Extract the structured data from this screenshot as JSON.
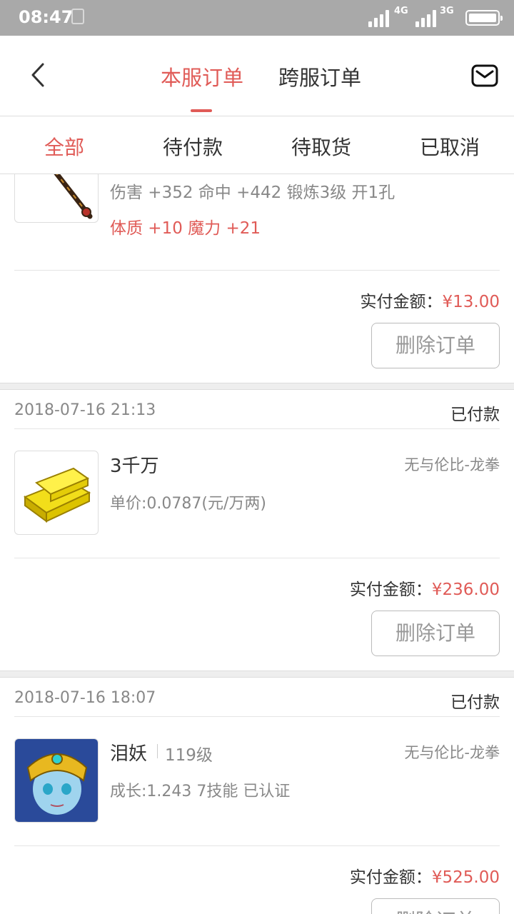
{
  "status_bar": {
    "time": "08:47",
    "net1": "4G",
    "net2": "3G"
  },
  "header": {
    "tabs": [
      {
        "label": "本服订单",
        "active": true
      },
      {
        "label": "跨服订单",
        "active": false
      }
    ]
  },
  "filters": [
    {
      "label": "全部",
      "active": true
    },
    {
      "label": "待付款",
      "active": false
    },
    {
      "label": "待取货",
      "active": false
    },
    {
      "label": "已取消",
      "active": false
    }
  ],
  "orders": [
    {
      "attr_line": "伤害 +352 命中 +442 锻炼3级 开1孔",
      "bonus_line": "体质 +10 魔力 +21",
      "paid_label": "实付金额：",
      "paid_amount": "¥13.00",
      "delete_label": "删除订单"
    },
    {
      "date": "2018-07-16 21:13",
      "status": "已付款",
      "name": "3千万",
      "server": "无与伦比-龙拳",
      "detail": "单价:0.0787(元/万两)",
      "paid_label": "实付金额：",
      "paid_amount": "¥236.00",
      "delete_label": "删除订单"
    },
    {
      "date": "2018-07-16 18:07",
      "status": "已付款",
      "name": "泪妖",
      "level": "119级",
      "server": "无与伦比-龙拳",
      "detail": "成长:1.243 7技能 已认证",
      "paid_label": "实付金额：",
      "paid_amount": "¥525.00",
      "delete_label": "删除订单"
    }
  ],
  "colors": {
    "accent": "#e05b57",
    "status_bar": "#a9a9a9"
  },
  "icons": [
    "back-arrow-icon",
    "mail-icon",
    "battery-icon",
    "signal-icon"
  ]
}
